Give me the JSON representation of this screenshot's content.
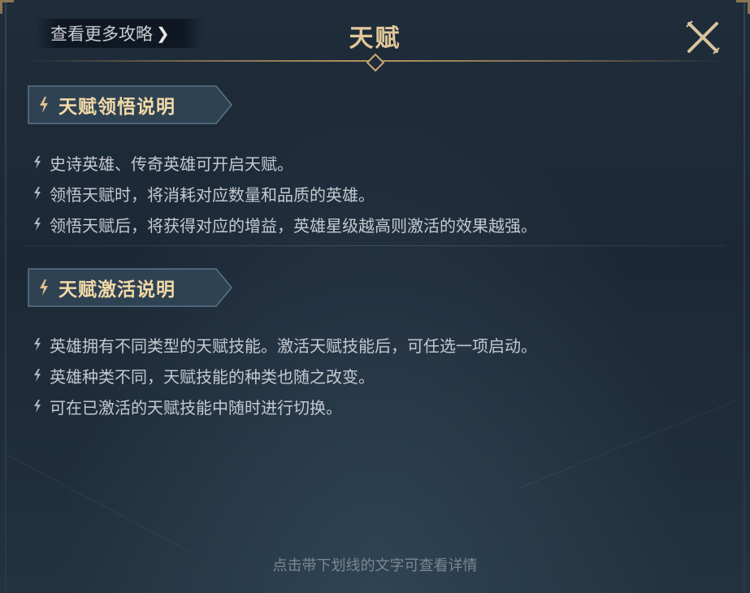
{
  "header": {
    "guide_link": "查看更多攻略",
    "guide_chevron": "❯",
    "title": "天赋"
  },
  "sections": [
    {
      "title": "天赋领悟说明",
      "items": [
        "史诗英雄、传奇英雄可开启天赋。",
        "领悟天赋时，将消耗对应数量和品质的英雄。",
        "领悟天赋后，将获得对应的增益，英雄星级越高则激活的效果越强。"
      ]
    },
    {
      "title": "天赋激活说明",
      "items": [
        "英雄拥有不同类型的天赋技能。激活天赋技能后，可任选一项启动。",
        "英雄种类不同，天赋技能的种类也随之改变。",
        "可在已激活的天赋技能中随时进行切换。"
      ]
    }
  ],
  "footer": {
    "hint": "点击带下划线的文字可查看详情"
  },
  "colors": {
    "accent_gold": "#e2c79a",
    "section_title": "#f1d9a7",
    "body_text": "#c4c9cf",
    "background": "#1d2a37"
  },
  "icons": [
    "close-icon",
    "chevron-right-icon",
    "spark-bullet-icon"
  ]
}
